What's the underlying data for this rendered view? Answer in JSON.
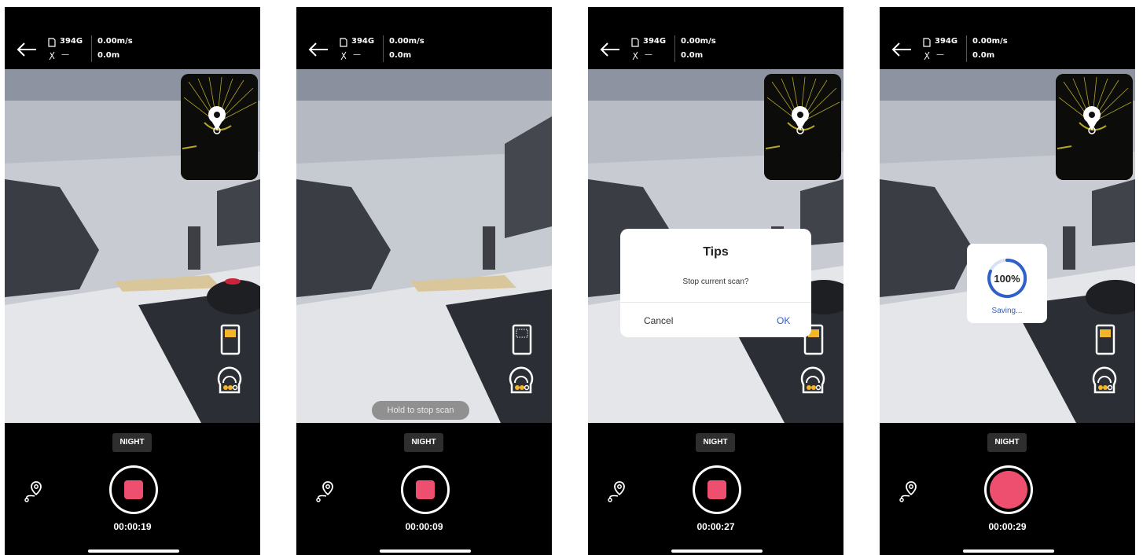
{
  "screens": [
    {
      "status": {
        "storage": "394G",
        "gps": "—",
        "speed": "0.00m/s",
        "distance": "0.0m"
      },
      "mode_label": "NIGHT",
      "timer": "00:00:19",
      "record_state": "recording",
      "battery_icon": "battery-icon"
    },
    {
      "status": {
        "storage": "394G",
        "gps": "—",
        "speed": "0.00m/s",
        "distance": "0.0m"
      },
      "mode_label": "NIGHT",
      "timer": "00:00:09",
      "record_state": "recording",
      "toast": "Hold to stop scan",
      "battery_icon": "empty-battery-icon"
    },
    {
      "status": {
        "storage": "394G",
        "gps": "—",
        "speed": "0.00m/s",
        "distance": "0.0m"
      },
      "mode_label": "NIGHT",
      "timer": "00:00:27",
      "record_state": "recording",
      "dialog": {
        "title": "Tips",
        "message": "Stop current scan?",
        "cancel": "Cancel",
        "ok": "OK"
      },
      "battery_icon": "battery-icon"
    },
    {
      "status": {
        "storage": "394G",
        "gps": "—",
        "speed": "0.00m/s",
        "distance": "0.0m"
      },
      "mode_label": "NIGHT",
      "timer": "00:00:29",
      "record_state": "saving",
      "saving": {
        "percent": "100%",
        "label": "Saving..."
      },
      "battery_icon": "battery-icon"
    }
  ],
  "colors": {
    "record_red": "#ef4f6e",
    "accent_blue": "#2a5ec9",
    "battery_yellow": "#f5b52a"
  }
}
